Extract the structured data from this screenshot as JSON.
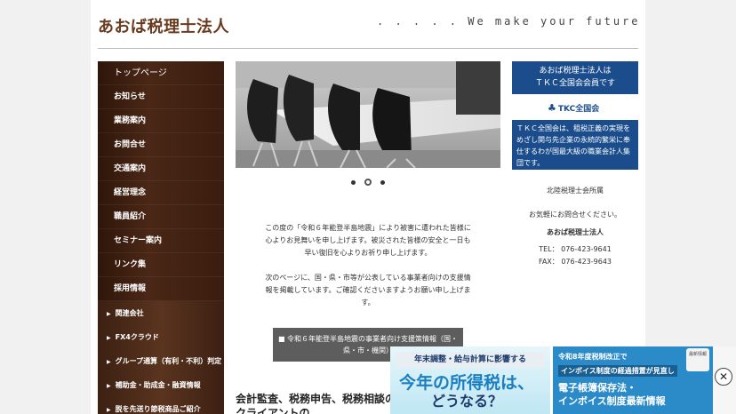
{
  "header": {
    "site_title": "あおば税理士法人",
    "tagline": ". . . . . We make your future"
  },
  "sidebar": {
    "items": [
      {
        "label": "トップページ",
        "kind": "top"
      },
      {
        "label": "お知らせ",
        "kind": "main"
      },
      {
        "label": "業務案内",
        "kind": "main"
      },
      {
        "label": "お問合せ",
        "kind": "main"
      },
      {
        "label": "交通案内",
        "kind": "main"
      },
      {
        "label": "経営理念",
        "kind": "main"
      },
      {
        "label": "職員紹介",
        "kind": "main"
      },
      {
        "label": "セミナー案内",
        "kind": "main"
      },
      {
        "label": "リンク集",
        "kind": "main"
      },
      {
        "label": "採用情報",
        "kind": "main"
      },
      {
        "label": "関連会社",
        "kind": "sub"
      },
      {
        "label": "FX4クラウド",
        "kind": "sub"
      },
      {
        "label": "グループ通算（有利・不利）判定",
        "kind": "sub"
      },
      {
        "label": "補助金・助成金・融資情報",
        "kind": "sub"
      },
      {
        "label": "脱を先送り節税商品ご紹介",
        "kind": "sub"
      }
    ]
  },
  "slider": {
    "alt": "会議室の写真",
    "dots": 3,
    "active_dot": 2
  },
  "main": {
    "notice": [
      "この度の「令和６年能登半島地震」により被害に遭われた皆様に心よりお見舞いを申し上げます。被災された皆様の安全と一日も早い復旧を心よりお祈り申し上げます。",
      "次のページに、国・県・市等が公表している事業者向けの支援情報を掲載しています。ご確認くださいますようお願い申し上げます。"
    ],
    "support_button": "■ 令和６年能登半島地震の事業者向け支援策情報（国・県・市・機関）",
    "services_heading": "会計監査、税務申告、税務相談の他、経営・財務に関するクライアントの"
  },
  "right": {
    "tkc_box": "あおば税理士法人は\nＴＫＣ全国会会員です",
    "tkc_logo": "TKC全国会",
    "tkc_desc": "ＴＫＣ全国会は、租税正義の実現をめざし関与先企業の永続的繁栄に奉仕するわが国最大級の職業会計人集団です。",
    "office_label": "北陸税理士会所属",
    "contact_line": "お気軽にお問合せください。",
    "contact_name": "あおば税理士法人",
    "tel": "TEL：  076-423-9641",
    "fax": "FAX：  076-423-9643"
  },
  "banners": {
    "left": {
      "line1": "年末調整・給与計算に影響する",
      "line2": "今年の所得税は、",
      "line3": "どうなる？"
    },
    "right": {
      "line1": "令和8年度税制改正で",
      "line2": "インボイス制度の経過措置が見直し",
      "line3": "電子帳簿保存法・",
      "line4": "インボイス制度最新情報",
      "tag": "最新情報"
    },
    "close_label": "✕"
  },
  "colors": {
    "brand_brown": "#6a3a1f",
    "sidebar_dark": "#3a1d0f",
    "tkc_blue": "#1b4d8c",
    "banner_blue": "#2b8bc9"
  }
}
